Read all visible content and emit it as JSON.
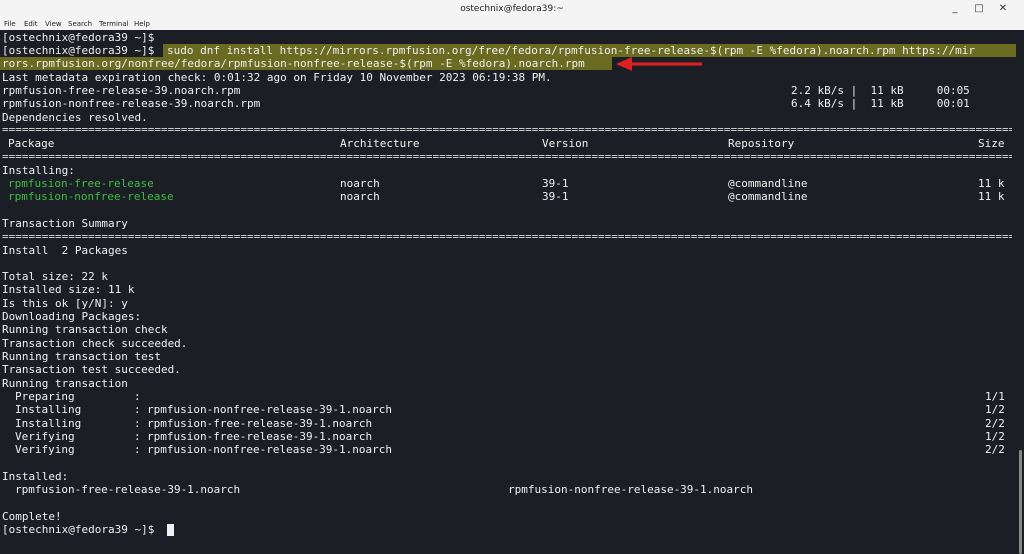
{
  "window": {
    "title": "ostechnix@fedora39:~",
    "controls": [
      "_",
      "□",
      "✕"
    ]
  },
  "menu": [
    "File",
    "Edit",
    "View",
    "Search",
    "Terminal",
    "Help"
  ],
  "terminal": {
    "prompt": "[ostechnix@fedora39 ~]$",
    "command_line1": "sudo dnf install https://mirrors.rpmfusion.org/free/fedora/rpmfusion-free-release-$(rpm -E %fedora).noarch.rpm https://mir",
    "command_line2": "rors.rpmfusion.org/nonfree/fedora/rpmfusion-nonfree-release-$(rpm -E %fedora).noarch.rpm",
    "metadata": "Last metadata expiration check: 0:01:32 ago on Friday 10 November 2023 06:19:38 PM.",
    "downloads": [
      {
        "name": "rpmfusion-free-release-39.noarch.rpm",
        "speed": "2.2 kB/s |  11 kB     00:05"
      },
      {
        "name": "rpmfusion-nonfree-release-39.noarch.rpm",
        "speed": "6.4 kB/s |  11 kB     00:01"
      }
    ],
    "deps_resolved": "Dependencies resolved.",
    "table_header": {
      "package": "Package",
      "arch": "Architecture",
      "version": "Version",
      "repo": "Repository",
      "size": "Size"
    },
    "installing_label": "Installing:",
    "packages": [
      {
        "name": "rpmfusion-free-release",
        "arch": "noarch",
        "version": "39-1",
        "repo": "@commandline",
        "size": "11 k"
      },
      {
        "name": "rpmfusion-nonfree-release",
        "arch": "noarch",
        "version": "39-1",
        "repo": "@commandline",
        "size": "11 k"
      }
    ],
    "transaction_summary": "Transaction Summary",
    "install_count": "Install  2 Packages",
    "total_size": "Total size: 22 k",
    "installed_size": "Installed size: 11 k",
    "confirm": "Is this ok [y/N]: y",
    "progress_lines": [
      "Downloading Packages:",
      "Running transaction check",
      "Transaction check succeeded.",
      "Running transaction test",
      "Transaction test succeeded.",
      "Running transaction"
    ],
    "steps": [
      {
        "action": "Preparing",
        "target": "",
        "progress": "1/1"
      },
      {
        "action": "Installing",
        "target": "rpmfusion-nonfree-release-39-1.noarch",
        "progress": "1/2"
      },
      {
        "action": "Installing",
        "target": "rpmfusion-free-release-39-1.noarch",
        "progress": "2/2"
      },
      {
        "action": "Verifying",
        "target": "rpmfusion-free-release-39-1.noarch",
        "progress": "1/2"
      },
      {
        "action": "Verifying",
        "target": "rpmfusion-nonfree-release-39-1.noarch",
        "progress": "2/2"
      }
    ],
    "installed_label": "Installed:",
    "installed": [
      "rpmfusion-free-release-39-1.noarch",
      "rpmfusion-nonfree-release-39-1.noarch"
    ],
    "complete": "Complete!"
  },
  "colors": {
    "background": "#1c1e26",
    "text": "#f0f0f0",
    "package_green": "#3dbf3d",
    "highlight": "#6a6a20",
    "arrow": "#e02020"
  }
}
